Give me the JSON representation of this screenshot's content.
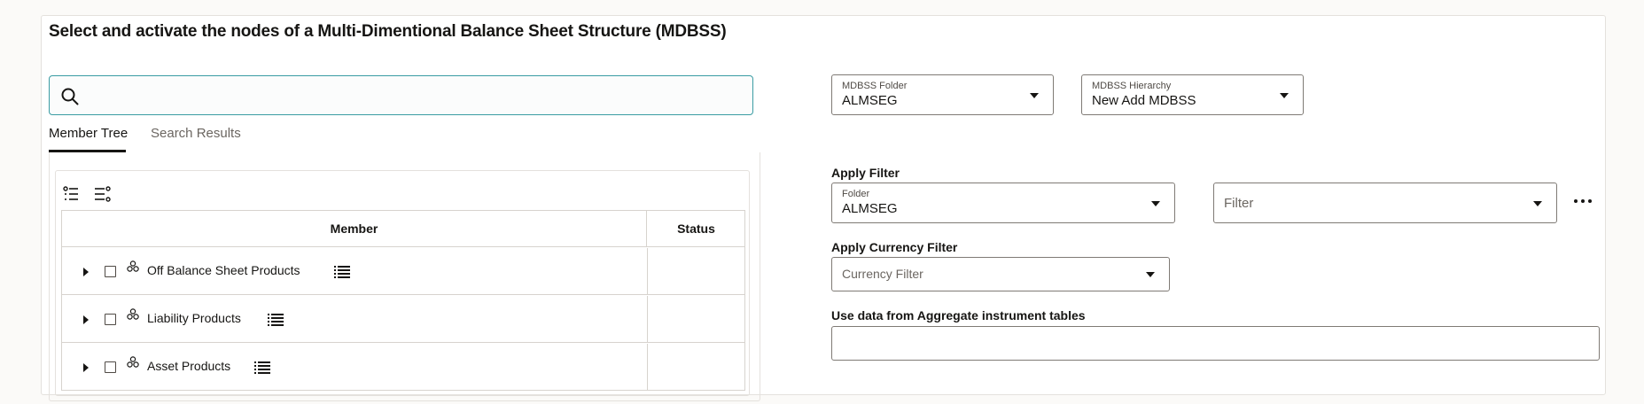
{
  "page": {
    "title": "Select and activate the nodes of a Multi-Dimentional Balance Sheet Structure (MDBSS)"
  },
  "search": {
    "value": "",
    "placeholder": ""
  },
  "tabs": [
    {
      "label": "Member Tree",
      "active": true
    },
    {
      "label": "Search Results",
      "active": false
    }
  ],
  "toolbar": {
    "expand_icon": "expand-all-icon",
    "collapse_icon": "collapse-all-icon"
  },
  "grid": {
    "columns": [
      "Member",
      "Status"
    ],
    "rows": [
      {
        "member": "Off Balance Sheet Products",
        "status": "",
        "checked": false,
        "expanded": false
      },
      {
        "member": "Liability Products",
        "status": "",
        "checked": false,
        "expanded": false
      },
      {
        "member": "Asset Products",
        "status": "",
        "checked": false,
        "expanded": false
      }
    ]
  },
  "mdbss_folder": {
    "label": "MDBSS Folder",
    "value": "ALMSEG"
  },
  "mdbss_hierarchy": {
    "label": "MDBSS Hierarchy",
    "value": "New Add MDBSS"
  },
  "apply_filter": {
    "section_label": "Apply Filter",
    "folder": {
      "label": "Folder",
      "value": "ALMSEG"
    },
    "filter": {
      "placeholder": "Filter"
    },
    "more_icon": "more-options-icon"
  },
  "currency_filter": {
    "section_label": "Apply Currency Filter",
    "placeholder": "Currency Filter"
  },
  "aggregate": {
    "section_label": "Use data from Aggregate instrument tables",
    "value": ""
  },
  "colors": {
    "accent": "#3a9ca3",
    "text": "#161513",
    "muted": "#6b6661",
    "border": "#d7d3ce"
  }
}
